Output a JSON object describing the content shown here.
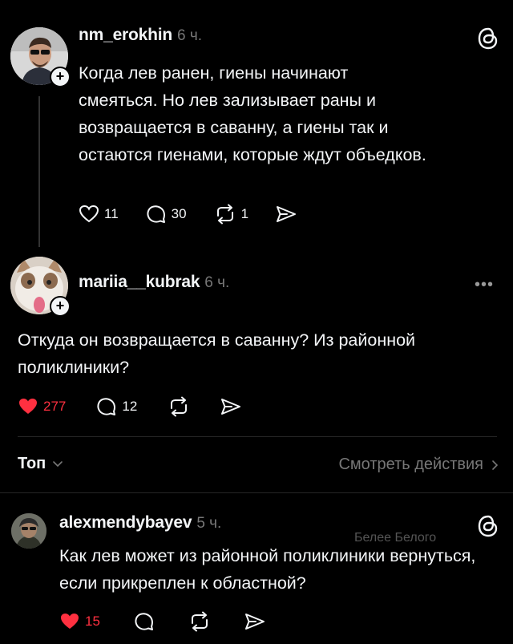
{
  "post1": {
    "username": "nm_erokhin",
    "time": "6 ч.",
    "text": "Когда лев ранен, гиены начинают смеяться. Но лев зализывает раны и возвращается в саванну, а гиены так и остаются гиенами, которые ждут объедков.",
    "likes": "11",
    "comments": "30",
    "reposts": "1"
  },
  "post2": {
    "username": "mariia__kubrak",
    "time": "6 ч.",
    "text": "Откуда он возвращается в саванну? Из районной поликлиники?",
    "likes": "277",
    "comments": "12"
  },
  "sort": {
    "label": "Топ",
    "view_activity": "Смотреть действия"
  },
  "post3": {
    "username": "alexmendybayev",
    "time": "5 ч.",
    "watermark": "Белее Белого",
    "text": "Как лев может из районной поликлиники вернуться, если прикреплен к областной?",
    "likes": "15"
  },
  "colors": {
    "background": "#000000",
    "text": "#f3f5f7",
    "muted": "#777777",
    "like_red": "#ff3040"
  }
}
